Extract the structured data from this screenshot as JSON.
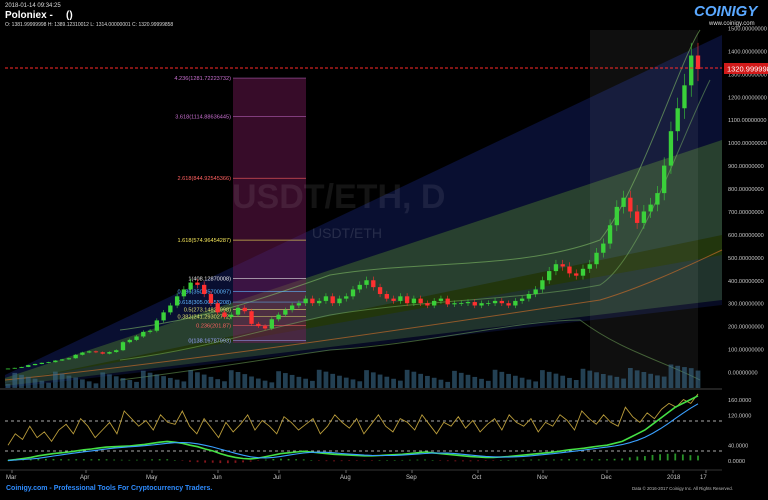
{
  "header": {
    "timestamp": "2018-01-14 09:34:25",
    "exchange": "Poloniex -",
    "pair_parens": "()",
    "ohlc": "O: 1381.99999998 H: 1389.12310012 L: 1314.00000001 C: 1320.99999858"
  },
  "brand": {
    "logo": "COINIGY",
    "url": "www.coinigy.com"
  },
  "watermark": {
    "symbol": "USDT/ETH, D",
    "sub": "USDT/ETH"
  },
  "footer": {
    "tagline": "Coinigy.com - Professional Tools For Cryptocurrency Traders.",
    "copyright": "Data © 2016-2017 Coinigy Inc. All Rights Reserved."
  },
  "colors": {
    "background": "#000000",
    "candle_up": "#3ad13a",
    "candle_down": "#ff3030",
    "current_price_line": "#ff2a2a",
    "current_price_badge": "#d11a1a",
    "axis_text": "#c8c8c8",
    "fib_1618": "#f5e65a",
    "fib_magenta": "#c86fd0",
    "fib_red": "#ff6060",
    "fib_blue": "#5fb8ff",
    "rsi_line": "#b89b3a",
    "macd_line": "#45e045",
    "signal_line": "#3aa0ff",
    "histogram": "#c0202a"
  },
  "chart_data": [
    {
      "type": "candlestick",
      "title": "USDT/ETH, D",
      "current_price_label": "1320.99999858",
      "current_price": 1321,
      "y_ticks": [
        "1500.00000000",
        "1400.00000000",
        "1300.00000000",
        "1200.00000000",
        "1100.00000000",
        "1000.00000000",
        "900.00000000",
        "800.00000000",
        "700.00000000",
        "600.00000000",
        "500.00000000",
        "400.00000000",
        "300.00000000",
        "200.00000000",
        "100.00000000",
        "0.00000000"
      ],
      "ylim": [
        0,
        1500
      ],
      "x_ticks": [
        "Mar",
        "Apr",
        "May",
        "Jun",
        "Jul",
        "Aug",
        "Sep",
        "Oct",
        "Nov",
        "Dec",
        "2018",
        "17"
      ],
      "fib_levels": [
        {
          "label": "4.236(1281.72223732)",
          "value": 1281.72
        },
        {
          "label": "3.618(1114.88636445)",
          "value": 1114.89
        },
        {
          "label": "2.618(844.92545366)",
          "value": 844.93
        },
        {
          "label": "1.618(574.96454287)",
          "value": 574.96
        },
        {
          "label": "1(408.12870008)",
          "value": 408.13
        },
        {
          "label": "0.786(350.35700097)",
          "value": 350.36
        },
        {
          "label": "0.618(305.00353208)",
          "value": 305.0
        },
        {
          "label": "0.5(273.14827998)",
          "value": 273.15
        },
        {
          "label": "0.382(241.29302772)",
          "value": 241.29
        },
        {
          "label": "0.236(201.87)",
          "value": 201.87
        },
        {
          "label": "0(138.16787993)",
          "value": 138.17
        }
      ],
      "series": [
        {
          "name": "close",
          "values": [
            15,
            18,
            22,
            30,
            35,
            40,
            43,
            50,
            55,
            60,
            75,
            85,
            90,
            86,
            80,
            87,
            95,
            130,
            140,
            155,
            175,
            180,
            225,
            260,
            290,
            330,
            360,
            390,
            380,
            340,
            300,
            260,
            240,
            250,
            280,
            265,
            210,
            200,
            190,
            230,
            250,
            270,
            290,
            300,
            320,
            300,
            310,
            330,
            300,
            320,
            330,
            360,
            380,
            400,
            370,
            340,
            320,
            310,
            330,
            300,
            320,
            300,
            290,
            310,
            320,
            295,
            300,
            300,
            305,
            290,
            300,
            300,
            310,
            300,
            290,
            310,
            320,
            340,
            360,
            400,
            440,
            470,
            460,
            430,
            420,
            450,
            470,
            520,
            560,
            640,
            720,
            760,
            700,
            650,
            700,
            730,
            780,
            900,
            1050,
            1150,
            1250,
            1380,
            1321
          ]
        }
      ]
    },
    {
      "type": "line",
      "title": "",
      "y_ticks": [
        "160.0000",
        "120.0000",
        "40.0000",
        "0.0000"
      ],
      "ylim": [
        -20,
        180
      ],
      "series": [
        {
          "name": "",
          "values": [
            40,
            70,
            55,
            90,
            60,
            75,
            50,
            80,
            95,
            70,
            110,
            90,
            60,
            80,
            100,
            70,
            130,
            110,
            90,
            105,
            80,
            120,
            100,
            95,
            130,
            90,
            70,
            110,
            85,
            60,
            100,
            75,
            95,
            120,
            80,
            105,
            90,
            70,
            115,
            100,
            80,
            95,
            110,
            70,
            90,
            120,
            100,
            85,
            110,
            70,
            95,
            120,
            90,
            75,
            110,
            100,
            80,
            120,
            95,
            70,
            100,
            90,
            115,
            85,
            105,
            75,
            95,
            110,
            80,
            120,
            100,
            90,
            110,
            75,
            100,
            90,
            120,
            105,
            80,
            130,
            110,
            95,
            120,
            100,
            90,
            140,
            115,
            100,
            125,
            110,
            135,
            150,
            140,
            160,
            150,
            175
          ]
        },
        {
          "name": "",
          "values": [
            0,
            2,
            5,
            8,
            12,
            15,
            18,
            20,
            22,
            25,
            28,
            30,
            33,
            35,
            36,
            37,
            38,
            40,
            42,
            45,
            48,
            50,
            48,
            45,
            40,
            36,
            30,
            25,
            18,
            12,
            8,
            5,
            4,
            6,
            10,
            14,
            18,
            20,
            22,
            24,
            22,
            20,
            18,
            16,
            15,
            14,
            13,
            12,
            12,
            13,
            14,
            15,
            16,
            18,
            20,
            22,
            20,
            18,
            16,
            14,
            12,
            10,
            9,
            8,
            8,
            9,
            10,
            12,
            14,
            16,
            18,
            20,
            22,
            25,
            28,
            30,
            32,
            35,
            38,
            40,
            45,
            50,
            60,
            70,
            80,
            95,
            110,
            125,
            140,
            150,
            160,
            170
          ]
        }
      ]
    }
  ]
}
